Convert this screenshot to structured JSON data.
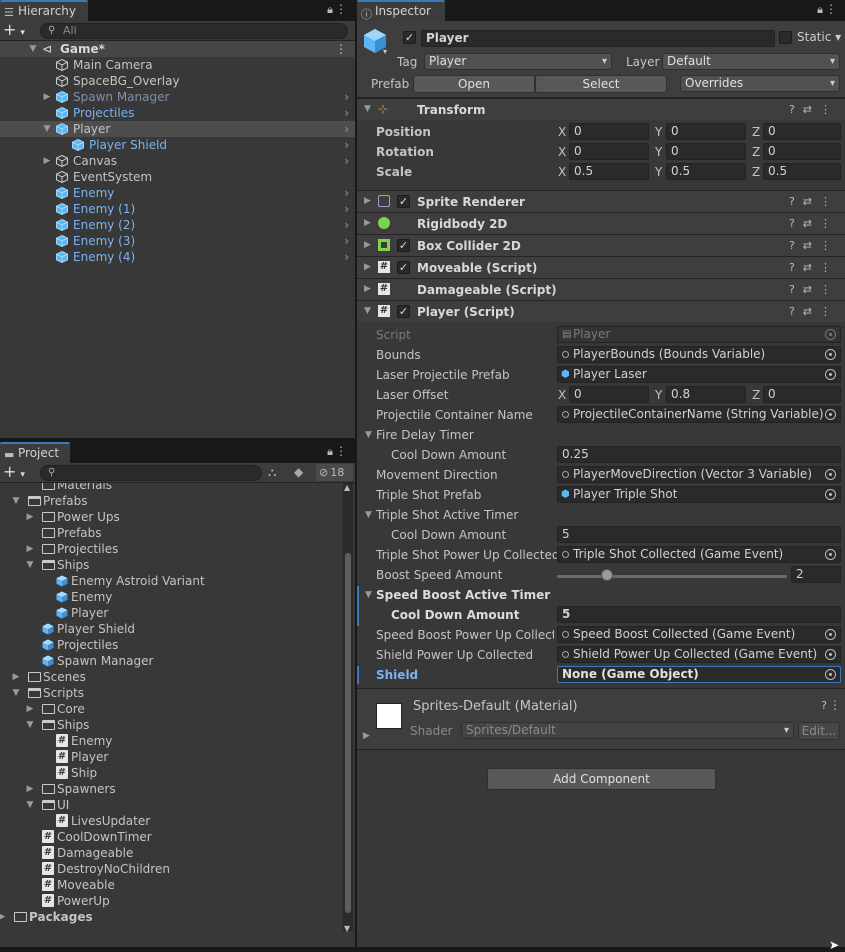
{
  "hierarchy": {
    "tab": "Hierarchy",
    "search_placeholder": "All",
    "add_label": "+",
    "scene": "Game*",
    "items": [
      {
        "label": "Main Camera"
      },
      {
        "label": "SpaceBG_Overlay"
      },
      {
        "label": "Spawn Manager"
      },
      {
        "label": "Projectiles"
      },
      {
        "label": "Player"
      },
      {
        "label": "Player Shield"
      },
      {
        "label": "Canvas"
      },
      {
        "label": "EventSystem"
      },
      {
        "label": "Enemy"
      },
      {
        "label": "Enemy (1)"
      },
      {
        "label": "Enemy (2)"
      },
      {
        "label": "Enemy (3)"
      },
      {
        "label": "Enemy (4)"
      }
    ]
  },
  "project": {
    "tab": "Project",
    "add_label": "+",
    "hidden_count": "18",
    "items": [
      {
        "label": "Materials"
      },
      {
        "label": "Prefabs"
      },
      {
        "label": "Power Ups"
      },
      {
        "label": "Prefabs"
      },
      {
        "label": "Projectiles"
      },
      {
        "label": "Ships"
      },
      {
        "label": "Enemy Astroid Variant"
      },
      {
        "label": "Enemy"
      },
      {
        "label": "Player"
      },
      {
        "label": "Player Shield"
      },
      {
        "label": "Projectiles"
      },
      {
        "label": "Spawn Manager"
      },
      {
        "label": "Scenes"
      },
      {
        "label": "Scripts"
      },
      {
        "label": "Core"
      },
      {
        "label": "Ships"
      },
      {
        "label": "Enemy"
      },
      {
        "label": "Player"
      },
      {
        "label": "Ship"
      },
      {
        "label": "Spawners"
      },
      {
        "label": "UI"
      },
      {
        "label": "LivesUpdater"
      },
      {
        "label": "CoolDownTimer"
      },
      {
        "label": "Damageable"
      },
      {
        "label": "DestroyNoChildren"
      },
      {
        "label": "Moveable"
      },
      {
        "label": "PowerUp"
      },
      {
        "label": "Packages"
      }
    ]
  },
  "inspector": {
    "tab": "Inspector",
    "object_name": "Player",
    "static_label": "Static",
    "tag_label": "Tag",
    "tag_value": "Player",
    "layer_label": "Layer",
    "layer_value": "Default",
    "prefab_label": "Prefab",
    "open_label": "Open",
    "select_label": "Select",
    "overrides_label": "Overrides",
    "transform": {
      "title": "Transform",
      "position_label": "Position",
      "rotation_label": "Rotation",
      "scale_label": "Scale",
      "x": "X",
      "y": "Y",
      "z": "Z",
      "position": [
        "0",
        "0",
        "0"
      ],
      "rotation": [
        "0",
        "0",
        "0"
      ],
      "scale": [
        "0.5",
        "0.5",
        "0.5"
      ]
    },
    "components": [
      {
        "title": "Sprite Renderer"
      },
      {
        "title": "Rigidbody 2D"
      },
      {
        "title": "Box Collider 2D"
      },
      {
        "title": "Moveable (Script)"
      },
      {
        "title": "Damageable (Script)"
      },
      {
        "title": "Player (Script)"
      }
    ],
    "player_script": {
      "script_label": "Script",
      "script_value": "Player",
      "bounds_label": "Bounds",
      "bounds_value": "PlayerBounds (Bounds Variable)",
      "laser_label": "Laser Projectile Prefab",
      "laser_value": "Player Laser",
      "offset_label": "Laser Offset",
      "offset": [
        "0",
        "0.8",
        "0"
      ],
      "container_label": "Projectile Container Name",
      "container_value": "ProjectileContainerName (String Variable)",
      "fire_delay_label": "Fire Delay Timer",
      "fire_cooldown_label": "Cool Down Amount",
      "fire_cooldown_value": "0.25",
      "move_dir_label": "Movement Direction",
      "move_dir_value": "PlayerMoveDirection (Vector 3 Variable)",
      "triple_prefab_label": "Triple Shot Prefab",
      "triple_prefab_value": "Player Triple Shot",
      "triple_timer_label": "Triple Shot Active Timer",
      "triple_cooldown_label": "Cool Down Amount",
      "triple_cooldown_value": "5",
      "triple_collected_label": "Triple Shot Power Up Collected",
      "triple_collected_value": "Triple Shot Collected (Game Event)",
      "boost_amount_label": "Boost Speed Amount",
      "boost_amount_value": "2",
      "boost_slider_fraction": 0.2,
      "speed_timer_label": "Speed Boost Active Timer",
      "speed_cooldown_label": "Cool Down Amount",
      "speed_cooldown_value": "5",
      "speed_collected_label": "Speed Boost Power Up Collecte",
      "speed_collected_value": "Speed Boost Collected (Game Event)",
      "shield_collected_label": "Shield Power Up Collected",
      "shield_collected_value": "Shield Power Up Collected (Game Event)",
      "shield_label": "Shield",
      "shield_value": "None (Game Object)"
    },
    "material": {
      "title": "Sprites-Default (Material)",
      "shader_label": "Shader",
      "shader_value": "Sprites/Default",
      "edit_label": "Edit..."
    },
    "add_component_label": "Add Component"
  }
}
